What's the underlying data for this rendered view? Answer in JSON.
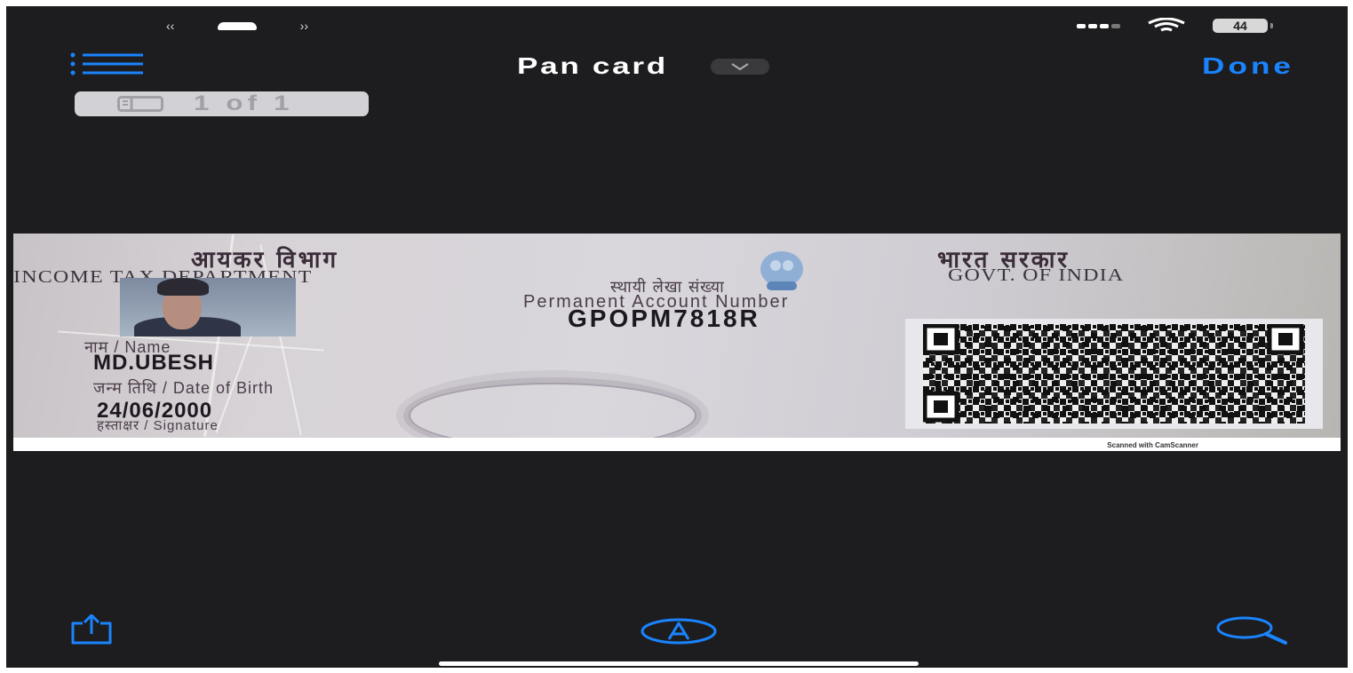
{
  "status_bar": {
    "battery_level": "44"
  },
  "nav": {
    "title": "Pan card",
    "done_label": "Done"
  },
  "page_indicator": {
    "label": "1 of 1"
  },
  "document": {
    "dept_hindi": "आयकर विभाग",
    "dept_english": "INCOME TAX DEPARTMENT",
    "govt_hindi": "भारत सरकार",
    "govt_english": "GOVT. OF INDIA",
    "pan_label_hindi": "स्थायी लेखा संख्या",
    "pan_label": "Permanent Account Number",
    "pan_number": "GPOPM7818R",
    "name_label": "नाम / Name",
    "name_value": "MD.UBESH",
    "dob_label": "जन्म तिथि / Date of Birth",
    "dob_value": "24/06/2000",
    "signature_label": "हस्ताक्षर / Signature",
    "watermark": "Scanned with CamScanner"
  },
  "toolbar": {
    "share_icon": "share-icon",
    "markup_icon": "markup-icon",
    "search_icon": "search-icon"
  },
  "colors": {
    "accent": "#1a84ff",
    "background": "#1d1d1f"
  }
}
